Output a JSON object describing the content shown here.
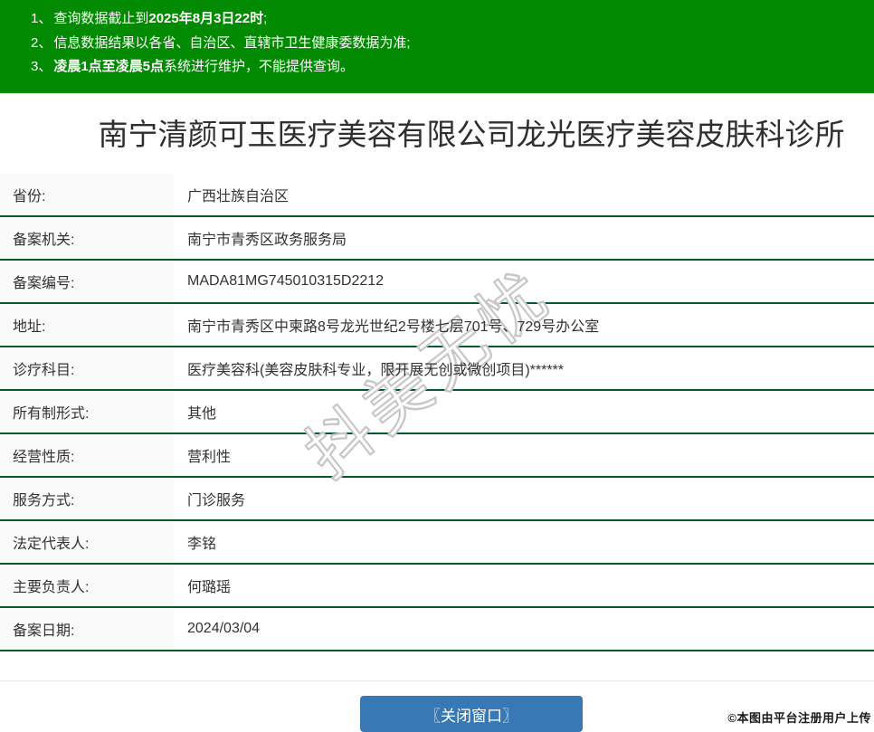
{
  "notice": {
    "items": [
      {
        "num": "1、",
        "pre": "查询数据截止到",
        "bold": "2025年8月3日22时",
        "post": ";"
      },
      {
        "num": "2、",
        "pre": "信息数据结果以各省、自治区、直辖市卫生健康委数据为准;",
        "bold": "",
        "post": ""
      },
      {
        "num": "3、",
        "pre": "",
        "bold": "凌晨1点至凌晨5点",
        "post": "系统进行维护，不能提供查询。"
      }
    ]
  },
  "title": "南宁清颜可玉医疗美容有限公司龙光医疗美容皮肤科诊所",
  "table": {
    "rows": [
      {
        "label": "省份:",
        "value": "广西壮族自治区"
      },
      {
        "label": "备案机关:",
        "value": "南宁市青秀区政务服务局"
      },
      {
        "label": "备案编号:",
        "value": "MADA81MG745010315D2212"
      },
      {
        "label": "地址:",
        "value": "南宁市青秀区中柬路8号龙光世纪2号楼七层701号、729号办公室"
      },
      {
        "label": "诊疗科目:",
        "value": "医疗美容科(美容皮肤科专业，限开展无创或微创项目)******"
      },
      {
        "label": "所有制形式:",
        "value": "其他"
      },
      {
        "label": "经营性质:",
        "value": "营利性"
      },
      {
        "label": "服务方式:",
        "value": "门诊服务"
      },
      {
        "label": "法定代表人:",
        "value": "李铭"
      },
      {
        "label": "主要负责人:",
        "value": "何璐瑶"
      },
      {
        "label": "备案日期:",
        "value": "2024/03/04"
      }
    ]
  },
  "close_button": {
    "label": "〖关闭窗口〗"
  },
  "watermark": {
    "text": "抖美无忧"
  },
  "credit": "©本图由平台注册用户上传",
  "colors": {
    "header_green": "#028B02",
    "row_border_green": "#005B2E",
    "button_blue": "#3879B5",
    "label_bg": "#FAFAFA",
    "text": "#333333"
  }
}
